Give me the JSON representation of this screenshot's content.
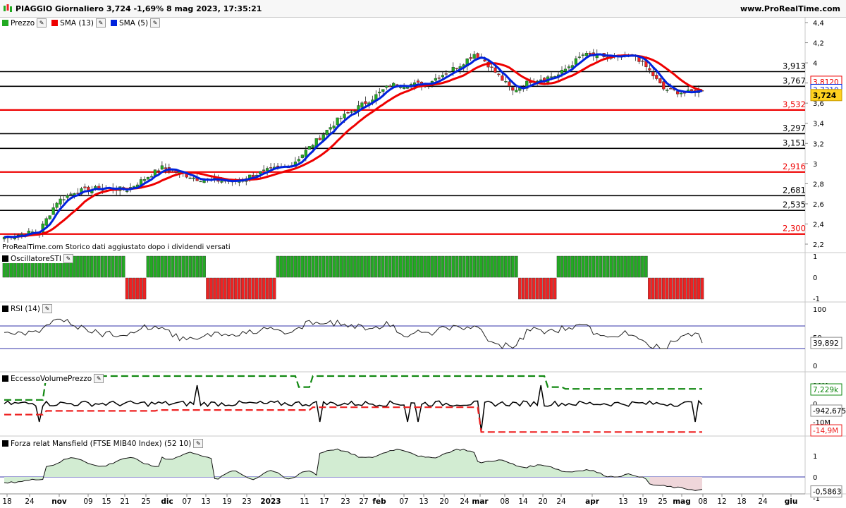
{
  "header": {
    "title": "PIAGGIO Giornaliero 3,724 -1,69% 8 mag 2023, 17:35:21",
    "site": "www.ProRealTime.com"
  },
  "colors": {
    "price_up": "#22aa22",
    "price_down": "#ee2222",
    "sma13": "#ee0000",
    "sma5": "#0022dd",
    "level_black": "#000000",
    "level_red": "#ee0000",
    "sti_pos": "#22aa22",
    "sti_neg": "#ee2222",
    "mansfield_fill": "#d2ecd2",
    "mansfield_fill_neg": "#efd6da"
  },
  "panels": {
    "price": {
      "legend": [
        "Prezzo",
        "SMA (13)",
        "SMA (5)"
      ],
      "note": "ProRealTime.com  Storico dati aggiustato dopo i dividendi versati",
      "axis_ticks": [
        "4,4",
        "4,2",
        "4",
        "3,8",
        "3,6",
        "3,4",
        "3,2",
        "3",
        "2,8",
        "2,6",
        "2,4",
        "2,2"
      ],
      "price_tag": "3,724",
      "sma13_tag": "3,8120",
      "sma5_tag": "3,7310"
    },
    "sti": {
      "legend": "OscillatoreSTI",
      "axis_ticks": [
        "1",
        "0",
        "-1"
      ]
    },
    "rsi": {
      "legend": "RSI (14)",
      "axis_ticks": [
        "100",
        "50",
        "0"
      ],
      "value_tag": "39,892"
    },
    "evp": {
      "legend": "EccessoVolumePrezzo",
      "axis_ticks": [
        "10M",
        "0",
        "-10M"
      ],
      "tags": [
        "7,229k",
        "-942,675",
        "-14,9M"
      ]
    },
    "mansfield": {
      "legend": "Forza relat Mansfield (FTSE MIB40 Index) (52 10)",
      "axis_ticks": [
        "1",
        "0",
        "-1"
      ],
      "value_tag": "-0,5863"
    }
  },
  "x_axis_labels": [
    "18",
    "24",
    "nov",
    "09",
    "15",
    "21",
    "25",
    "dic",
    "07",
    "13",
    "19",
    "23",
    "2023",
    "11",
    "17",
    "23",
    "27",
    "feb",
    "07",
    "13",
    "20",
    "24",
    "mar",
    "08",
    "14",
    "20",
    "24",
    "apr",
    "13",
    "19",
    "25",
    "mag",
    "08",
    "12",
    "18",
    "24",
    "giu"
  ],
  "chart_data": {
    "type": "candlestick",
    "title": "PIAGGIO Giornaliero",
    "price_ylim": [
      2.2,
      4.45
    ],
    "last_price": 3.724,
    "change_pct": -1.69,
    "horizontal_levels": [
      {
        "value": 3.913,
        "label": "3,913",
        "color": "black"
      },
      {
        "value": 3.767,
        "label": "3,767",
        "color": "black"
      },
      {
        "value": 3.532,
        "label": "3,532",
        "color": "red"
      },
      {
        "value": 3.297,
        "label": "3,297",
        "color": "black"
      },
      {
        "value": 3.151,
        "label": "3,151",
        "color": "black"
      },
      {
        "value": 2.916,
        "label": "2,916",
        "color": "red"
      },
      {
        "value": 2.681,
        "label": "2,681",
        "color": "black"
      },
      {
        "value": 2.535,
        "label": "2,535",
        "color": "black"
      },
      {
        "value": 2.3,
        "label": "2,300",
        "color": "red"
      }
    ],
    "close_anchors": [
      [
        0,
        2.27
      ],
      [
        10,
        2.33
      ],
      [
        15,
        2.62
      ],
      [
        20,
        2.72
      ],
      [
        28,
        2.76
      ],
      [
        35,
        2.74
      ],
      [
        45,
        2.96
      ],
      [
        55,
        2.85
      ],
      [
        65,
        2.82
      ],
      [
        75,
        2.93
      ],
      [
        82,
        2.99
      ],
      [
        95,
        3.43
      ],
      [
        105,
        3.65
      ],
      [
        110,
        3.78
      ],
      [
        120,
        3.79
      ],
      [
        130,
        3.98
      ],
      [
        134,
        4.09
      ],
      [
        137,
        4.02
      ],
      [
        145,
        3.72
      ],
      [
        150,
        3.82
      ],
      [
        158,
        3.88
      ],
      [
        165,
        4.08
      ],
      [
        175,
        4.05
      ],
      [
        180,
        4.07
      ],
      [
        184,
        3.92
      ],
      [
        188,
        3.74
      ],
      [
        194,
        3.7
      ],
      [
        197,
        3.72
      ]
    ],
    "sti_segments": [
      {
        "from": 0,
        "to": 34,
        "value": 1
      },
      {
        "from": 35,
        "to": 40,
        "value": -1
      },
      {
        "from": 41,
        "to": 57,
        "value": 1
      },
      {
        "from": 58,
        "to": 77,
        "value": -1
      },
      {
        "from": 78,
        "to": 146,
        "value": 1
      },
      {
        "from": 147,
        "to": 157,
        "value": -1
      },
      {
        "from": 158,
        "to": 183,
        "value": 1
      },
      {
        "from": 184,
        "to": 199,
        "value": -1
      }
    ],
    "rsi_levels": [
      70,
      30
    ],
    "rsi_last": 39.892,
    "mansfield_last": -0.5863,
    "evp_last": -942.675
  }
}
